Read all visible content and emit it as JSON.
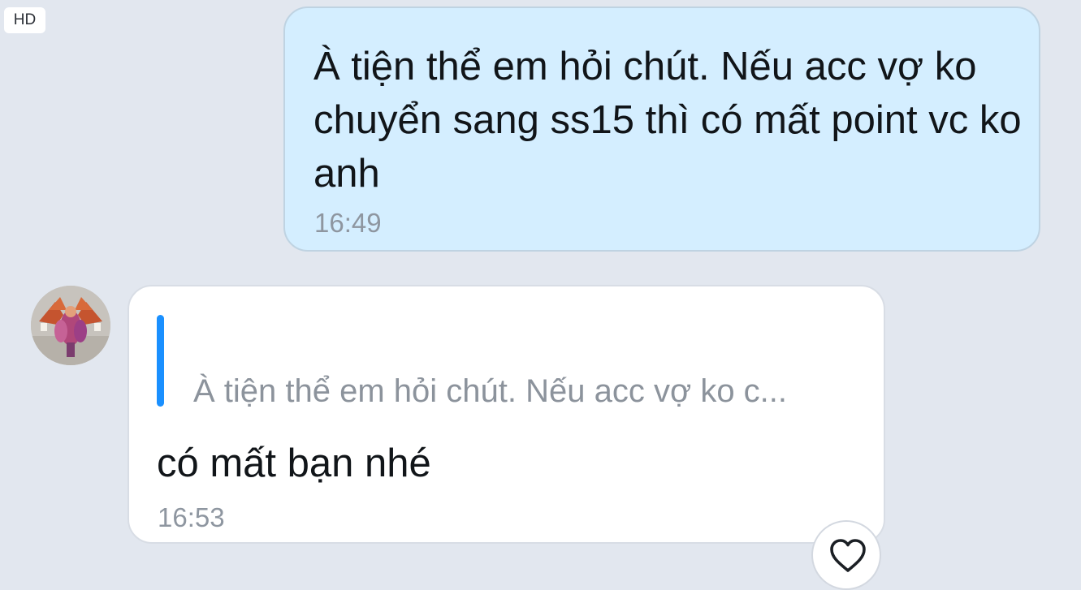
{
  "badge": {
    "label": "HD"
  },
  "messages": [
    {
      "direction": "outgoing",
      "text": "À tiện thể em hỏi chút. Nếu acc vợ ko chuyển sang ss15 thì có mất point vc ko anh",
      "time": "16:49"
    },
    {
      "direction": "incoming",
      "quote": "À tiện thể em hỏi chút. Nếu acc vợ ko c...",
      "text": "có mất bạn nhé",
      "time": "16:53"
    }
  ],
  "icons": {
    "react": "heart-outline-icon"
  },
  "colors": {
    "background": "#e2e7ef",
    "sent_bubble": "#d4eeff",
    "received_bubble": "#ffffff",
    "quote_accent": "#1a90ff",
    "timestamp": "#8e96a0"
  }
}
